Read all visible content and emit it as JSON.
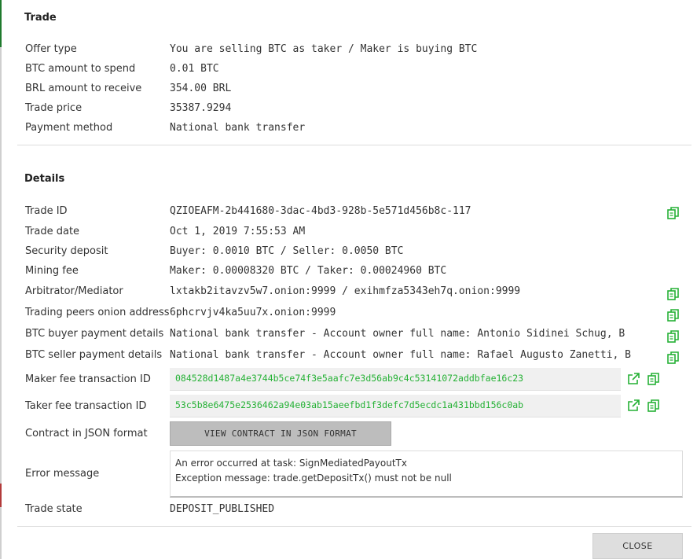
{
  "colors": {
    "green": "#25b135",
    "accent_bar": "#1f7a2e"
  },
  "trade": {
    "title": "Trade",
    "rows": [
      {
        "label": "Offer type",
        "value": "You are selling BTC as taker / Maker is buying BTC"
      },
      {
        "label": "BTC amount to spend",
        "value": "0.01 BTC"
      },
      {
        "label": "BRL amount to receive",
        "value": "354.00 BRL"
      },
      {
        "label": "Trade price",
        "value": "35387.9294"
      },
      {
        "label": "Payment method",
        "value": "National bank transfer"
      }
    ]
  },
  "details": {
    "title": "Details",
    "trade_id": {
      "label": "Trade ID",
      "value": "QZIOEAFM-2b441680-3dac-4bd3-928b-5e571d456b8c-117"
    },
    "trade_date": {
      "label": "Trade date",
      "value": "Oct 1, 2019 7:55:53 AM"
    },
    "security_deposit": {
      "label": "Security deposit",
      "value": "Buyer: 0.0010 BTC / Seller: 0.0050 BTC"
    },
    "mining_fee": {
      "label": "Mining fee",
      "value": "Maker: 0.00008320 BTC / Taker: 0.00024960 BTC"
    },
    "arbitrator": {
      "label": "Arbitrator/Mediator",
      "value": "lxtakb2itavzv5w7.onion:9999 / exihmfza5343eh7q.onion:9999"
    },
    "peers_onion": {
      "label": "Trading peers onion address",
      "value": "6phcrvjv4ka5uu7x.onion:9999"
    },
    "buyer_payment": {
      "label": "BTC buyer payment details",
      "value": "National bank transfer - Account owner full name: Antonio Sidinei Schug, B"
    },
    "seller_payment": {
      "label": "BTC seller payment details",
      "value": "National bank transfer - Account owner full name: Rafael Augusto Zanetti, B"
    },
    "maker_fee_tx": {
      "label": "Maker fee transaction ID",
      "value": "084528d1487a4e3744b5ce74f3e5aafc7e3d56ab9c4c53141072addbfae16c23"
    },
    "taker_fee_tx": {
      "label": "Taker fee transaction ID",
      "value": "53c5b8e6475e2536462a94e03ab15aeefbd1f3defc7d5ecdc1a431bbd156c0ab"
    },
    "contract": {
      "label": "Contract in JSON format",
      "button": "VIEW CONTRACT IN JSON FORMAT"
    },
    "error": {
      "label": "Error message",
      "line1": "An error occurred at task: SignMediatedPayoutTx",
      "line2": "Exception message: trade.getDepositTx() must not be null"
    },
    "trade_state": {
      "label": "Trade state",
      "value": "DEPOSIT_PUBLISHED"
    }
  },
  "footer": {
    "close_label": "CLOSE"
  }
}
